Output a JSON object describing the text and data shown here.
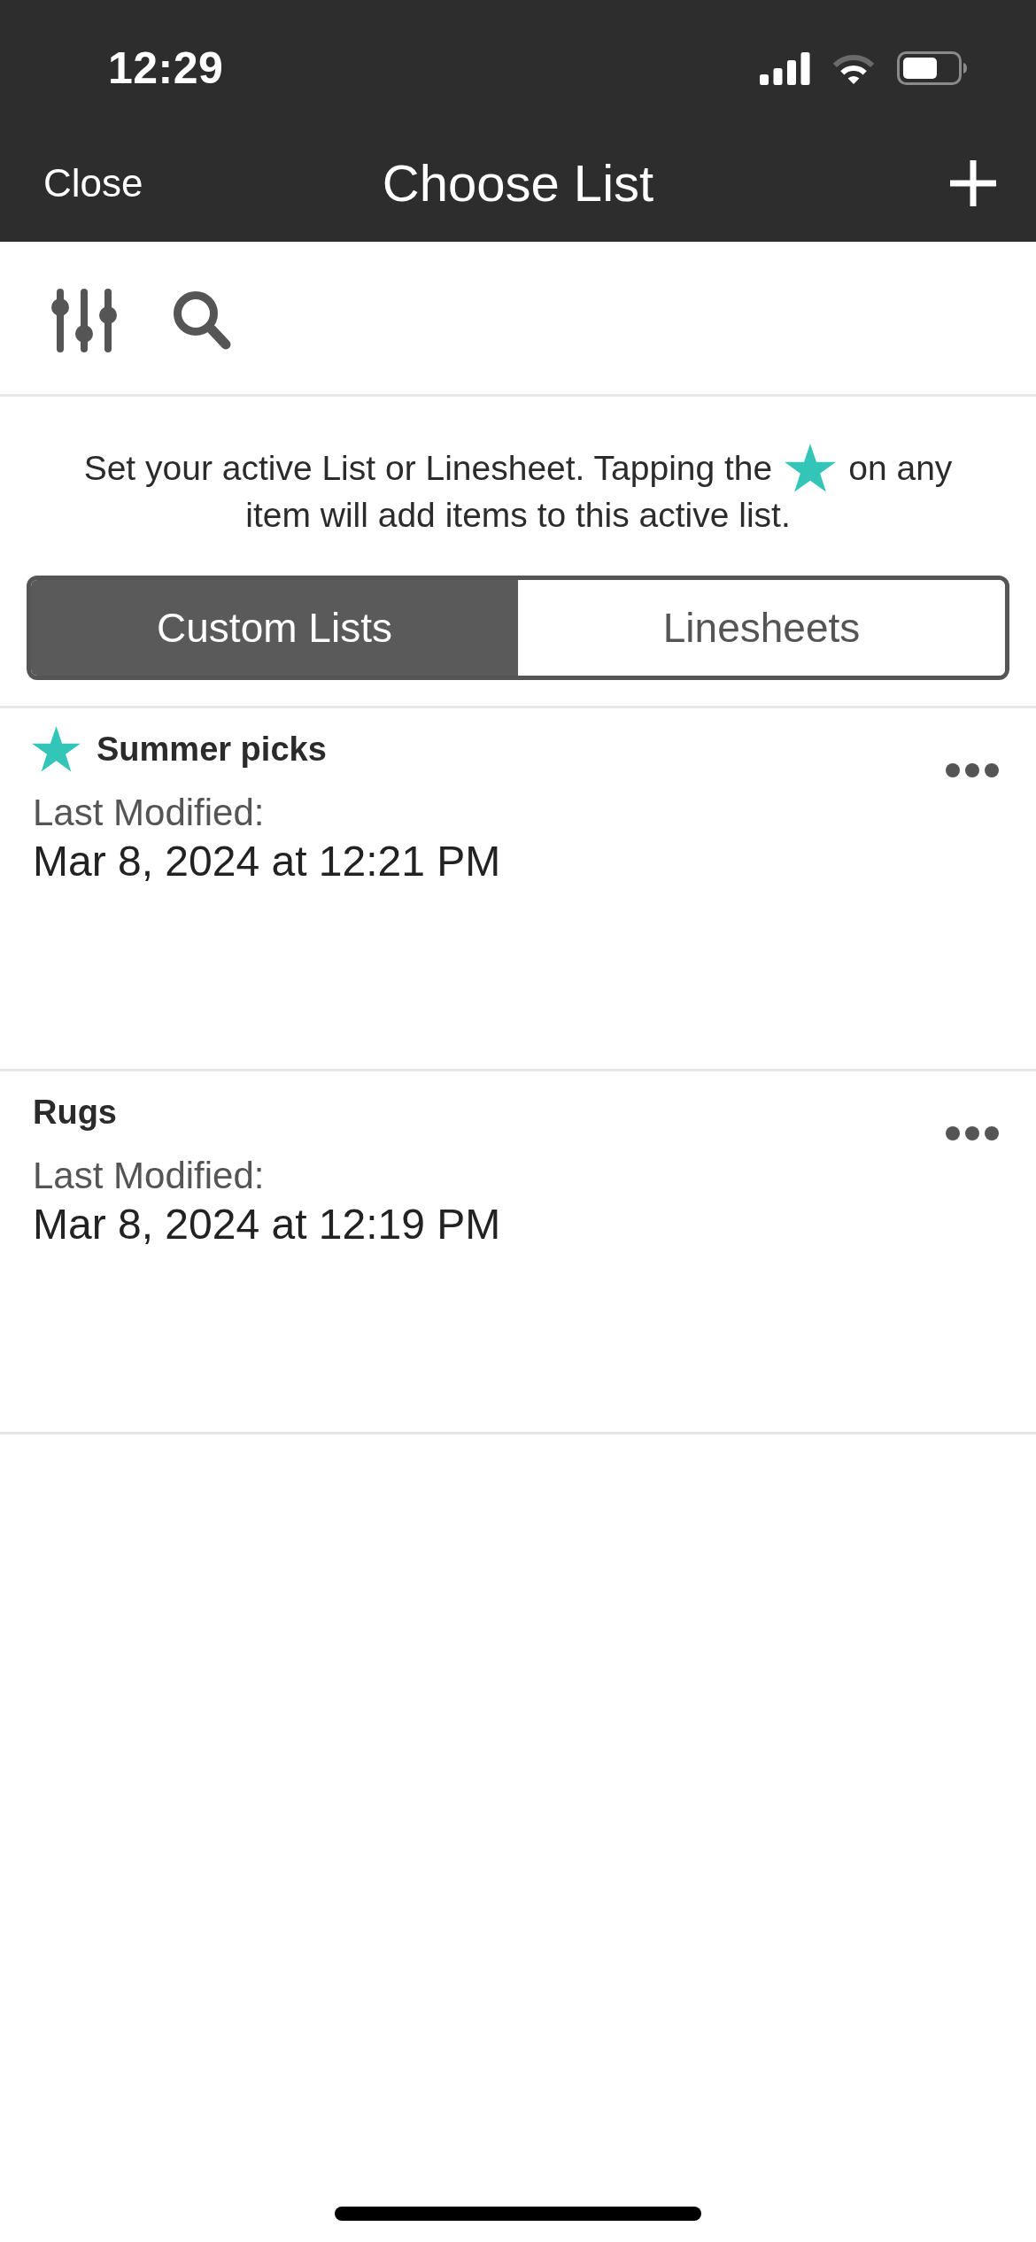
{
  "status_bar": {
    "time": "12:29"
  },
  "nav_bar": {
    "left_button": "Close",
    "title": "Choose List"
  },
  "instruction": {
    "line_1_before_star": "Set your active List or Linesheet. Tapping the",
    "line_1_after_star": "on any",
    "line_2": "item will add items to this active list."
  },
  "segments": [
    {
      "label": "Custom Lists",
      "selected": true
    },
    {
      "label": "Linesheets",
      "selected": false
    }
  ],
  "lists": [
    {
      "name": "Summer picks",
      "active": true,
      "modified_label": "Last Modified:",
      "modified": "Mar 8, 2024 at 12:21 PM"
    },
    {
      "name": "Rugs",
      "active": false,
      "modified_label": "Last Modified:",
      "modified": "Mar 8, 2024 at 12:19 PM"
    }
  ]
}
